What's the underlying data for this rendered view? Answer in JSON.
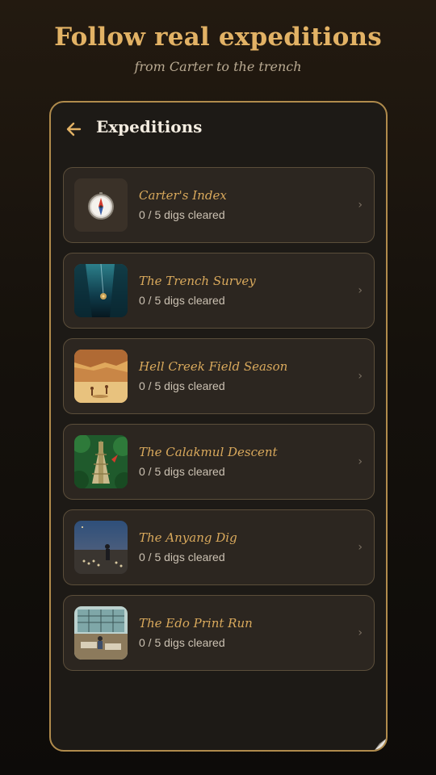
{
  "hero": {
    "title": "Follow real expeditions",
    "subtitle": "from Carter to the trench"
  },
  "header": {
    "title": "Expeditions",
    "back_icon": "arrow-left-icon"
  },
  "expeditions": [
    {
      "title": "Carter's Index",
      "progress": "0 / 5 digs cleared",
      "thumbnail": "compass-icon"
    },
    {
      "title": "The Trench Survey",
      "progress": "0 / 5 digs cleared",
      "thumbnail": "deep-sea-image"
    },
    {
      "title": "Hell Creek Field Season",
      "progress": "0 / 5 digs cleared",
      "thumbnail": "badlands-dig-image"
    },
    {
      "title": "The Calakmul Descent",
      "progress": "0 / 5 digs cleared",
      "thumbnail": "jungle-pyramid-image"
    },
    {
      "title": "The Anyang Dig",
      "progress": "0 / 5 digs cleared",
      "thumbnail": "night-dig-image"
    },
    {
      "title": "The Edo Print Run",
      "progress": "0 / 5 digs cleared",
      "thumbnail": "print-workshop-image"
    }
  ],
  "colors": {
    "accent_gold": "#e2b265",
    "card_title": "#d9a95c",
    "card_border": "#5b4e3a",
    "frame_border": "#b08b4c",
    "background": "#15110c"
  }
}
